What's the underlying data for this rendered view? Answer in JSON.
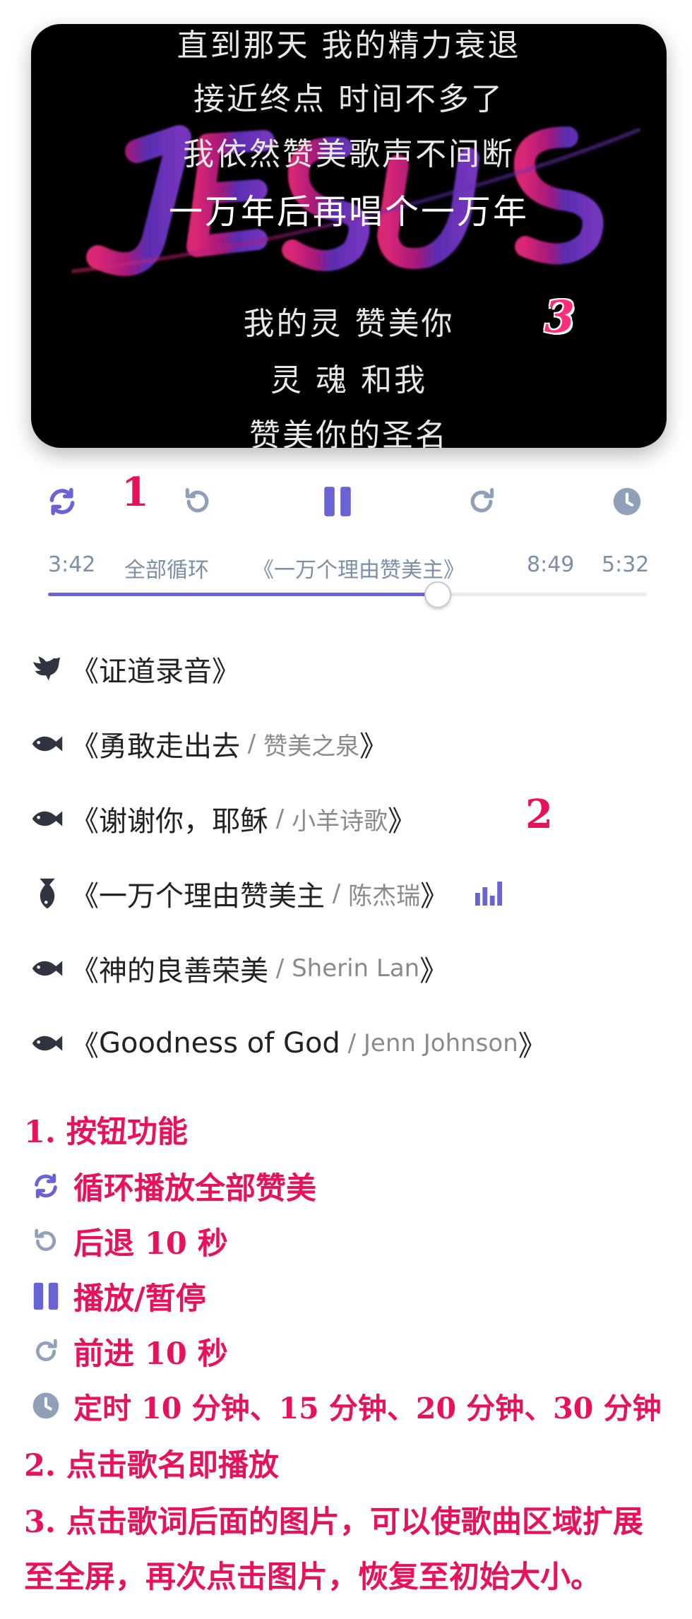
{
  "lyrics": {
    "lines": [
      "直到那天 我的精力衰退",
      "接近终点 时间不多了",
      "我依然赞美歌声不间断",
      "一万年后再唱个一万年",
      "我的灵 赞美你",
      "灵 魂 和我",
      "赞美你的圣名"
    ],
    "background_word": "JESUS",
    "annotation_number": "3"
  },
  "controls": {
    "annotation_number": "1",
    "loop_icon": "repeat-icon",
    "rewind_icon": "rewind-10-icon",
    "play_pause_icon": "pause-icon",
    "forward_icon": "forward-10-icon",
    "timer_icon": "clock-icon"
  },
  "player": {
    "elapsed": "3:42",
    "loop_mode": "全部循环",
    "current_song": "《一万个理由赞美主》",
    "duration": "8:49",
    "remaining": "5:32",
    "progress_fraction": 0.65
  },
  "songs": [
    {
      "icon": "dove-icon",
      "open": "《",
      "title": "证道录音",
      "sep": "",
      "artist": "",
      "close": "》",
      "playing": false
    },
    {
      "icon": "fish-icon",
      "open": "《",
      "title": "勇敢走出去",
      "sep": " / ",
      "artist": "赞美之泉",
      "close": "》",
      "playing": false
    },
    {
      "icon": "fish-icon",
      "open": "《",
      "title": "谢谢你，耶稣",
      "sep": " / ",
      "artist": "小羊诗歌",
      "close": "》",
      "playing": false
    },
    {
      "icon": "fish-up-icon",
      "open": "《",
      "title": "一万个理由赞美主",
      "sep": " / ",
      "artist": "陈杰瑞",
      "close": "》",
      "playing": true
    },
    {
      "icon": "fish-icon",
      "open": "《",
      "title": "神的良善荣美",
      "sep": " / ",
      "artist": "Sherin Lan",
      "close": "》",
      "playing": false
    },
    {
      "icon": "fish-icon",
      "open": "《",
      "title": "Goodness of God",
      "sep": " / ",
      "artist": "Jenn Johnson",
      "close": "》",
      "playing": false
    }
  ],
  "songs_annotation_number": "2",
  "notes": {
    "heading1": "1. 按钮功能",
    "loop": "循环播放全部赞美",
    "rewind": "后退 10 秒",
    "play_pause": "播放/暂停",
    "forward": "前进 10 秒",
    "timer": "定时 10 分钟、15 分钟、20 分钟、30 分钟",
    "heading2": "2. 点击歌名即播放",
    "heading3_line1": "3. 点击歌词后面的图片，可以使歌曲区域扩展",
    "heading3_line2": "至全屏，再次点击图片，恢复至初始大小。"
  },
  "colors": {
    "accent": "#6a63d6",
    "annotation_red": "#e8115b",
    "icon_gray": "#8fa0b8"
  }
}
